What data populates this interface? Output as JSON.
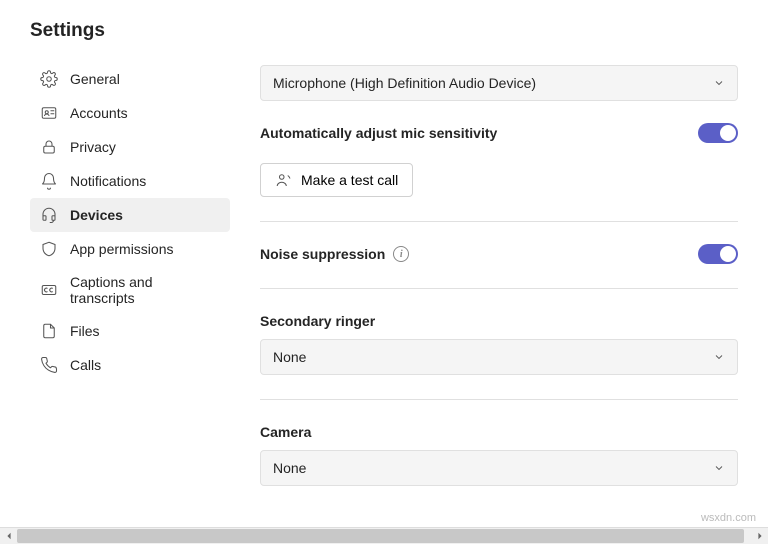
{
  "title": "Settings",
  "sidebar": {
    "items": [
      {
        "label": "General"
      },
      {
        "label": "Accounts"
      },
      {
        "label": "Privacy"
      },
      {
        "label": "Notifications"
      },
      {
        "label": "Devices"
      },
      {
        "label": "App permissions"
      },
      {
        "label": "Captions and transcripts"
      },
      {
        "label": "Files"
      },
      {
        "label": "Calls"
      }
    ]
  },
  "main": {
    "microphone": {
      "selected": "Microphone (High Definition Audio Device)"
    },
    "auto_mic": {
      "label": "Automatically adjust mic sensitivity"
    },
    "test_call": {
      "label": "Make a test call"
    },
    "noise": {
      "label": "Noise suppression"
    },
    "ringer": {
      "label": "Secondary ringer",
      "selected": "None"
    },
    "camera": {
      "label": "Camera",
      "selected": "None"
    }
  },
  "watermark": "wsxdn.com"
}
